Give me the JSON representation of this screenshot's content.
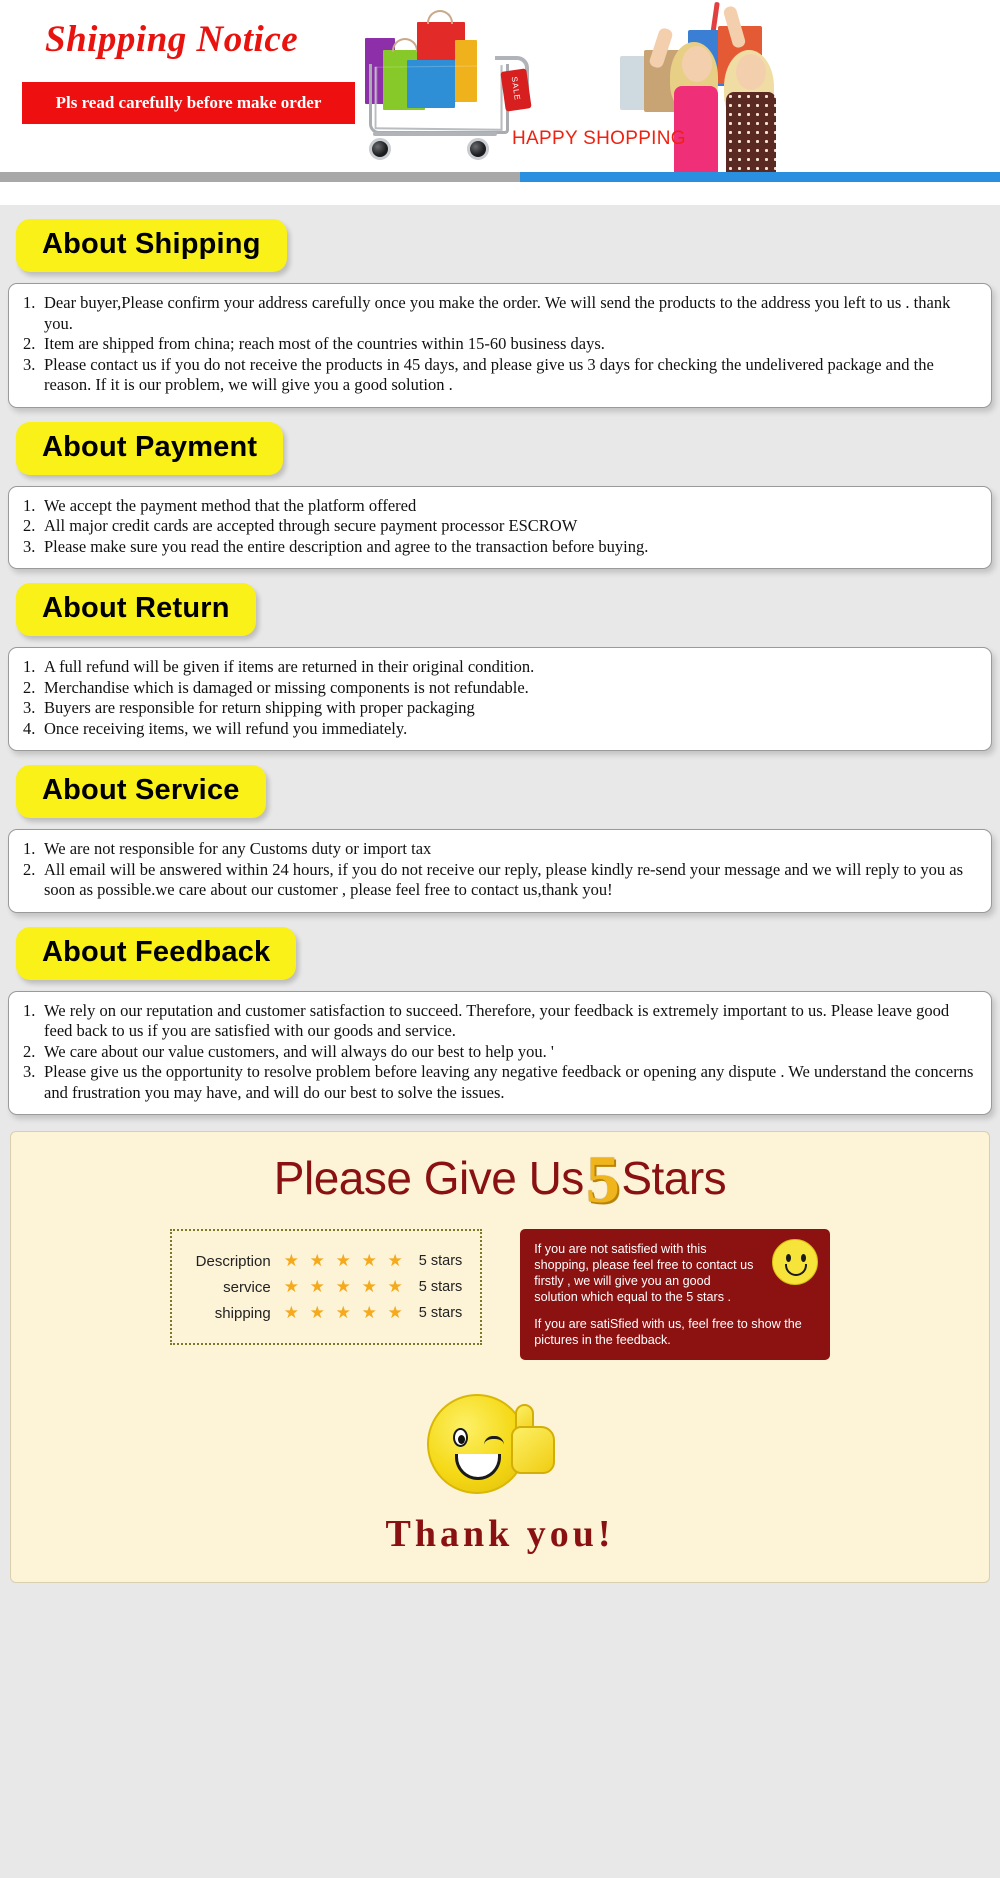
{
  "banner": {
    "title": "Shipping Notice",
    "subbar": "Pls read carefully before make order",
    "happy_shopping": "HAPPY SHOPPING",
    "sale_tag": "SALE",
    "accent_red": "#ee1010",
    "accent_blue": "#2b8fe0"
  },
  "sections": [
    {
      "heading": "About Shipping",
      "items": [
        "Dear buyer,Please confirm your address carefully once you make the order. We will send the products to the address you left to us . thank you.",
        "Item are shipped from china; reach most of the countries within 15-60 business days.",
        "Please contact us if you do not receive the products in 45 days, and please give us 3 days for checking the undelivered package and the reason. If it is our problem, we will give you a good solution ."
      ]
    },
    {
      "heading": "About Payment",
      "items": [
        "We accept the payment method that the platform offered",
        "All major credit cards are accepted through secure payment processor ESCROW",
        "Please make sure you read the entire description and agree to the transaction before buying."
      ]
    },
    {
      "heading": "About Return",
      "items": [
        "A full refund will be given if items are returned in their original condition.",
        "Merchandise which is damaged or missing components is not refundable.",
        "Buyers are responsible for return shipping with proper packaging",
        "Once receiving items, we will refund you immediately."
      ]
    },
    {
      "heading": "About Service",
      "items": [
        "We are not responsible for any Customs duty or import tax",
        "All email will be answered within 24 hours, if you do not receive our reply, please kindly re-send your message and we will reply to you as soon as possible.we care about our customer , please feel free to contact us,thank you!"
      ]
    },
    {
      "heading": "About Feedback",
      "items": [
        "We rely on our reputation and customer satisfaction to succeed. Therefore, your feedback is extremely important to us. Please leave good feed back to us if you are satisfied with our goods and service.",
        "We care about our value customers, and will always do our best to help you. '",
        "Please give us the opportunity to resolve problem before leaving any negative feedback or opening any dispute . We understand the concerns and frustration you may have, and will do our best to solve the issues."
      ]
    }
  ],
  "stars_panel": {
    "headline_before": "Please Give Us",
    "headline_number": "5",
    "headline_after": "Stars",
    "ratings": [
      {
        "label": "Description",
        "stars": "★ ★ ★ ★ ★",
        "value": "5 stars"
      },
      {
        "label": "service",
        "stars": "★ ★ ★ ★ ★",
        "value": "5 stars"
      },
      {
        "label": "shipping",
        "stars": "★ ★ ★ ★ ★",
        "value": "5 stars"
      }
    ],
    "redbox": {
      "line1": "If you are not satisfied with this shopping, please feel free to contact us firstly , we will give you an good solution which equal to the 5 stars .",
      "line2": "If you are satiSfied with us, feel free to show the pictures in the feedback."
    },
    "thank_you": "Thank you!",
    "star_color": "#f5a91c",
    "panel_bg": "#fdf3d7",
    "dark_red": "#8c1111"
  }
}
